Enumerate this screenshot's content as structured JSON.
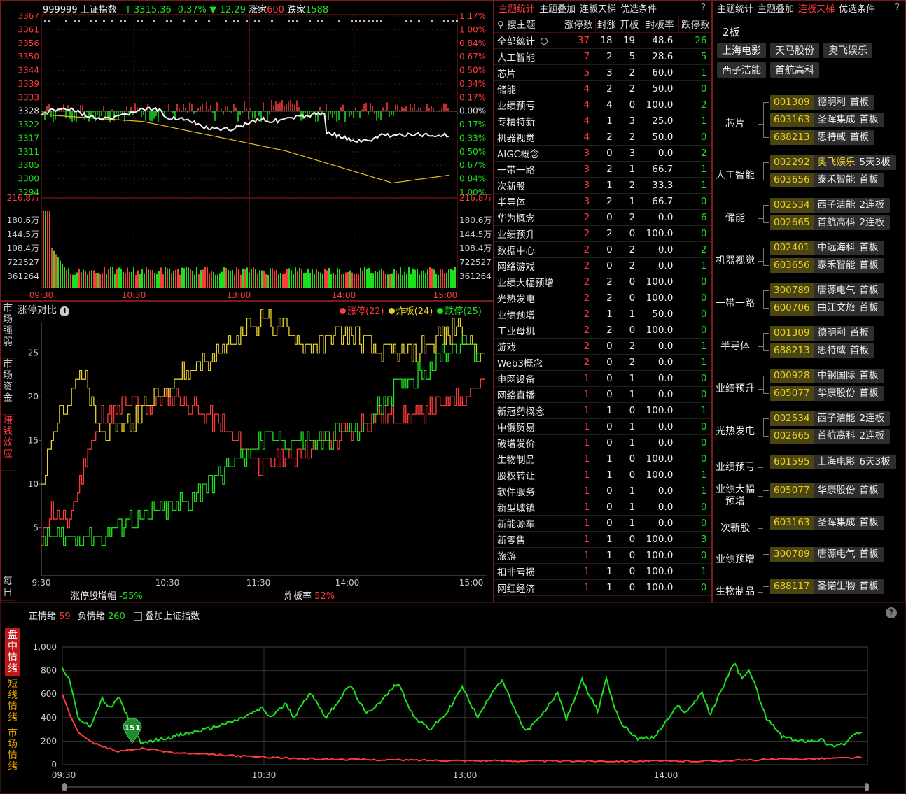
{
  "index": {
    "code": "999999",
    "name": "上证指数",
    "last": "3315.36",
    "pct": "-0.37%",
    "chg": "▼-12.29",
    "up_label": "涨家",
    "up": "600",
    "down_label": "跌家",
    "down": "1588",
    "price_labels": [
      "3367",
      "3361",
      "3356",
      "3350",
      "3344",
      "3339",
      "3333",
      "3328",
      "3322",
      "3317",
      "3311",
      "3305",
      "3300",
      "3294"
    ],
    "pct_labels": [
      "1.17%",
      "1.00%",
      "0.84%",
      "0.67%",
      "0.50%",
      "0.34%",
      "0.17%",
      "0.00%",
      "0.17%",
      "0.33%",
      "0.50%",
      "0.67%",
      "0.84%",
      "1.00%"
    ],
    "vol_labels": [
      "216.8万",
      "180.6万",
      "144.5万",
      "108.4万",
      "722527",
      "361264"
    ],
    "time_labels": [
      "09:30",
      "10:30",
      "13:00",
      "14:00",
      "15:00"
    ],
    "colors": {
      "up": "#ff3b3b",
      "down": "#1ee11e",
      "price": "#f0f0f0",
      "avg": "#e8c020"
    }
  },
  "limit_compare": {
    "title": "涨停对比",
    "legend": [
      {
        "label": "涨停(22)",
        "color": "#ff3b3b"
      },
      {
        "label": "炸板(24)",
        "color": "#e8d02a"
      },
      {
        "label": "跌停(25)",
        "color": "#1ee11e"
      }
    ],
    "y_ticks": [
      "25",
      "20",
      "15",
      "10",
      "5"
    ],
    "x_ticks": [
      "9:30",
      "10:30",
      "11:30",
      "14:00",
      "15:00"
    ],
    "footer_left_label": "涨停股增幅",
    "footer_left_value": "-55%",
    "footer_right_label": "炸板率",
    "footer_right_value": "52%",
    "side_tabs": [
      "市场强弱",
      "市场资金",
      "赚钱效应",
      "每日"
    ]
  },
  "theme_panel": {
    "tabs": [
      "主题统计",
      "主题叠加",
      "连板天梯",
      "优选条件",
      "?"
    ],
    "columns": [
      "搜主题",
      "涨停数",
      "封涨",
      "开板",
      "封板率",
      "跌停数"
    ],
    "summary": {
      "name": "全部统计",
      "limit_up": "37",
      "sealed": "18",
      "opened": "19",
      "rate": "48.6",
      "limit_down": "26"
    },
    "rows": [
      [
        "人工智能",
        "7",
        "2",
        "5",
        "28.6",
        "5"
      ],
      [
        "芯片",
        "5",
        "3",
        "2",
        "60.0",
        "1"
      ],
      [
        "储能",
        "4",
        "2",
        "2",
        "50.0",
        "0"
      ],
      [
        "业绩预亏",
        "4",
        "4",
        "0",
        "100.0",
        "2"
      ],
      [
        "专精特新",
        "4",
        "1",
        "3",
        "25.0",
        "1"
      ],
      [
        "机器视觉",
        "4",
        "2",
        "2",
        "50.0",
        "0"
      ],
      [
        "AIGC概念",
        "3",
        "0",
        "3",
        "0.0",
        "2"
      ],
      [
        "一带一路",
        "3",
        "2",
        "1",
        "66.7",
        "1"
      ],
      [
        "次新股",
        "3",
        "1",
        "2",
        "33.3",
        "1"
      ],
      [
        "半导体",
        "3",
        "2",
        "1",
        "66.7",
        "0"
      ],
      [
        "华为概念",
        "2",
        "0",
        "2",
        "0.0",
        "6"
      ],
      [
        "业绩预升",
        "2",
        "2",
        "0",
        "100.0",
        "0"
      ],
      [
        "数据中心",
        "2",
        "0",
        "2",
        "0.0",
        "2"
      ],
      [
        "网络游戏",
        "2",
        "0",
        "2",
        "0.0",
        "1"
      ],
      [
        "业绩大幅预增",
        "2",
        "2",
        "0",
        "100.0",
        "0"
      ],
      [
        "光热发电",
        "2",
        "2",
        "0",
        "100.0",
        "0"
      ],
      [
        "业绩预增",
        "2",
        "1",
        "1",
        "50.0",
        "0"
      ],
      [
        "工业母机",
        "2",
        "2",
        "0",
        "100.0",
        "0"
      ],
      [
        "游戏",
        "2",
        "0",
        "2",
        "0.0",
        "1"
      ],
      [
        "Web3概念",
        "2",
        "0",
        "2",
        "0.0",
        "1"
      ],
      [
        "电网设备",
        "1",
        "0",
        "1",
        "0.0",
        "0"
      ],
      [
        "网络直播",
        "1",
        "0",
        "1",
        "0.0",
        "0"
      ],
      [
        "新冠药概念",
        "1",
        "1",
        "0",
        "100.0",
        "1"
      ],
      [
        "中俄贸易",
        "1",
        "0",
        "1",
        "0.0",
        "0"
      ],
      [
        "破增发价",
        "1",
        "0",
        "1",
        "0.0",
        "0"
      ],
      [
        "生物制品",
        "1",
        "1",
        "0",
        "100.0",
        "0"
      ],
      [
        "股权转让",
        "1",
        "1",
        "0",
        "100.0",
        "1"
      ],
      [
        "软件服务",
        "1",
        "0",
        "1",
        "0.0",
        "1"
      ],
      [
        "新型城镇",
        "1",
        "0",
        "1",
        "0.0",
        "0"
      ],
      [
        "新能源车",
        "1",
        "0",
        "1",
        "0.0",
        "0"
      ],
      [
        "新零售",
        "1",
        "1",
        "0",
        "100.0",
        "3"
      ],
      [
        "旅游",
        "1",
        "1",
        "0",
        "100.0",
        "0"
      ],
      [
        "扣非亏损",
        "1",
        "1",
        "0",
        "100.0",
        "1"
      ],
      [
        "网红经济",
        "1",
        "1",
        "0",
        "100.0",
        "0"
      ]
    ]
  },
  "ladder_panel": {
    "tabs": [
      "主题统计",
      "主题叠加",
      "连板天梯",
      "优选条件",
      "?"
    ],
    "level": "2板",
    "top_stocks": [
      "上海电影",
      "天马股份",
      "奥飞娱乐",
      "西子洁能",
      "首航高科"
    ],
    "groups": [
      {
        "theme": "芯片",
        "stocks": [
          [
            "001309",
            "德明利",
            "首板"
          ],
          [
            "603163",
            "圣晖集成",
            "首板"
          ],
          [
            "688213",
            "思特威",
            "首板"
          ]
        ]
      },
      {
        "theme": "人工智能",
        "stocks": [
          [
            "002292",
            "奥飞娱乐",
            "5天3板"
          ],
          [
            "603656",
            "泰禾智能",
            "首板"
          ]
        ]
      },
      {
        "theme": "储能",
        "stocks": [
          [
            "002534",
            "西子洁能",
            "2连板"
          ],
          [
            "002665",
            "首航高科",
            "2连板"
          ]
        ]
      },
      {
        "theme": "机器视觉",
        "stocks": [
          [
            "002401",
            "中远海科",
            "首板"
          ],
          [
            "603656",
            "泰禾智能",
            "首板"
          ]
        ]
      },
      {
        "theme": "一带一路",
        "stocks": [
          [
            "300789",
            "唐源电气",
            "首板"
          ],
          [
            "600706",
            "曲江文旅",
            "首板"
          ]
        ]
      },
      {
        "theme": "半导体",
        "stocks": [
          [
            "001309",
            "德明利",
            "首板"
          ],
          [
            "688213",
            "思特威",
            "首板"
          ]
        ]
      },
      {
        "theme": "业绩预升",
        "stocks": [
          [
            "000928",
            "中钢国际",
            "首板"
          ],
          [
            "605077",
            "华康股份",
            "首板"
          ]
        ]
      },
      {
        "theme": "光热发电",
        "stocks": [
          [
            "002534",
            "西子洁能",
            "2连板"
          ],
          [
            "002665",
            "首航高科",
            "2连板"
          ]
        ]
      },
      {
        "theme": "业绩预亏",
        "stocks": [
          [
            "601595",
            "上海电影",
            "6天3板"
          ]
        ]
      },
      {
        "theme": "业绩大幅预增",
        "stocks": [
          [
            "605077",
            "华康股份",
            "首板"
          ]
        ]
      },
      {
        "theme": "次新股",
        "stocks": [
          [
            "603163",
            "圣晖集成",
            "首板"
          ]
        ]
      },
      {
        "theme": "业绩预增",
        "stocks": [
          [
            "300789",
            "唐源电气",
            "首板"
          ]
        ]
      },
      {
        "theme": "生物制品",
        "stocks": [
          [
            "688117",
            "圣诺生物",
            "首板"
          ]
        ]
      }
    ]
  },
  "sentiment": {
    "pos_label": "正情绪",
    "pos": "59",
    "neg_label": "负情绪",
    "neg": "260",
    "overlay_label": "叠加上证指数",
    "help": "?",
    "side_tabs": [
      "盘中情绪",
      "短线情绪",
      "市场情绪"
    ],
    "y_ticks": [
      "1,000",
      "800",
      "600",
      "400",
      "200",
      "0"
    ],
    "x_ticks": [
      "09:30",
      "10:30",
      "13:00",
      "14:00"
    ],
    "marker": "151"
  }
}
